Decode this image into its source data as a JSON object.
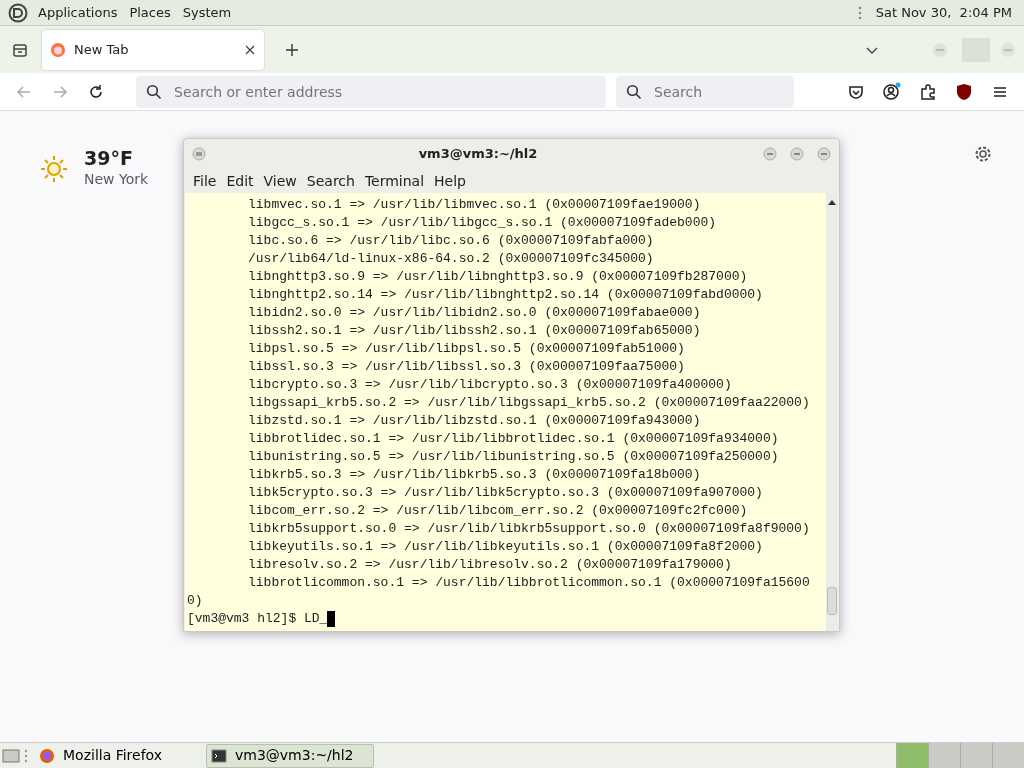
{
  "top_panel": {
    "menus": [
      "Applications",
      "Places",
      "System"
    ],
    "clock": "Sat Nov 30,  2:04 PM"
  },
  "browser": {
    "tabs": [
      {
        "label": "New Tab",
        "selected": true
      }
    ],
    "address_field": {
      "placeholder": "Search or enter address"
    },
    "search_field": {
      "placeholder": "Search"
    },
    "weather": {
      "temperature": "39°F",
      "location": "New York"
    }
  },
  "terminal": {
    "title": "vm3@vm3:~/hl2",
    "menus": [
      "File",
      "Edit",
      "View",
      "Search",
      "Terminal",
      "Help"
    ],
    "lines": [
      {
        "text": "libmvec.so.1 => /usr/lib/libmvec.so.1 (0x00007109fae19000)",
        "indented": true
      },
      {
        "text": "libgcc_s.so.1 => /usr/lib/libgcc_s.so.1 (0x00007109fadeb000)",
        "indented": true
      },
      {
        "text": "libc.so.6 => /usr/lib/libc.so.6 (0x00007109fabfa000)",
        "indented": true
      },
      {
        "text": "/usr/lib64/ld-linux-x86-64.so.2 (0x00007109fc345000)",
        "indented": true
      },
      {
        "text": "libnghttp3.so.9 => /usr/lib/libnghttp3.so.9 (0x00007109fb287000)",
        "indented": true
      },
      {
        "text": "libnghttp2.so.14 => /usr/lib/libnghttp2.so.14 (0x00007109fabd0000)",
        "indented": true
      },
      {
        "text": "libidn2.so.0 => /usr/lib/libidn2.so.0 (0x00007109fabae000)",
        "indented": true
      },
      {
        "text": "libssh2.so.1 => /usr/lib/libssh2.so.1 (0x00007109fab65000)",
        "indented": true
      },
      {
        "text": "libpsl.so.5 => /usr/lib/libpsl.so.5 (0x00007109fab51000)",
        "indented": true
      },
      {
        "text": "libssl.so.3 => /usr/lib/libssl.so.3 (0x00007109faa75000)",
        "indented": true
      },
      {
        "text": "libcrypto.so.3 => /usr/lib/libcrypto.so.3 (0x00007109fa400000)",
        "indented": true
      },
      {
        "text": "libgssapi_krb5.so.2 => /usr/lib/libgssapi_krb5.so.2 (0x00007109faa22000)",
        "indented": true
      },
      {
        "text": "libzstd.so.1 => /usr/lib/libzstd.so.1 (0x00007109fa943000)",
        "indented": true
      },
      {
        "text": "libbrotlidec.so.1 => /usr/lib/libbrotlidec.so.1 (0x00007109fa934000)",
        "indented": true
      },
      {
        "text": "libunistring.so.5 => /usr/lib/libunistring.so.5 (0x00007109fa250000)",
        "indented": true
      },
      {
        "text": "libkrb5.so.3 => /usr/lib/libkrb5.so.3 (0x00007109fa18b000)",
        "indented": true
      },
      {
        "text": "libk5crypto.so.3 => /usr/lib/libk5crypto.so.3 (0x00007109fa907000)",
        "indented": true
      },
      {
        "text": "libcom_err.so.2 => /usr/lib/libcom_err.so.2 (0x00007109fc2fc000)",
        "indented": true
      },
      {
        "text": "libkrb5support.so.0 => /usr/lib/libkrb5support.so.0 (0x00007109fa8f9000)",
        "indented": true
      },
      {
        "text": "libkeyutils.so.1 => /usr/lib/libkeyutils.so.1 (0x00007109fa8f2000)",
        "indented": true
      },
      {
        "text": "libresolv.so.2 => /usr/lib/libresolv.so.2 (0x00007109fa179000)",
        "indented": true
      },
      {
        "text": "libbrotlicommon.so.1 => /usr/lib/libbrotlicommon.so.1 (0x00007109fa15600",
        "indented": true
      },
      {
        "text": "0)",
        "indented": false
      }
    ],
    "prompt": "[vm3@vm3 hl2]$ LD_"
  },
  "taskbar": {
    "items": [
      {
        "label": "Mozilla Firefox",
        "kind": "browser",
        "selected": false
      },
      {
        "label": "vm3@vm3:~/hl2",
        "kind": "terminal",
        "selected": true
      }
    ]
  }
}
